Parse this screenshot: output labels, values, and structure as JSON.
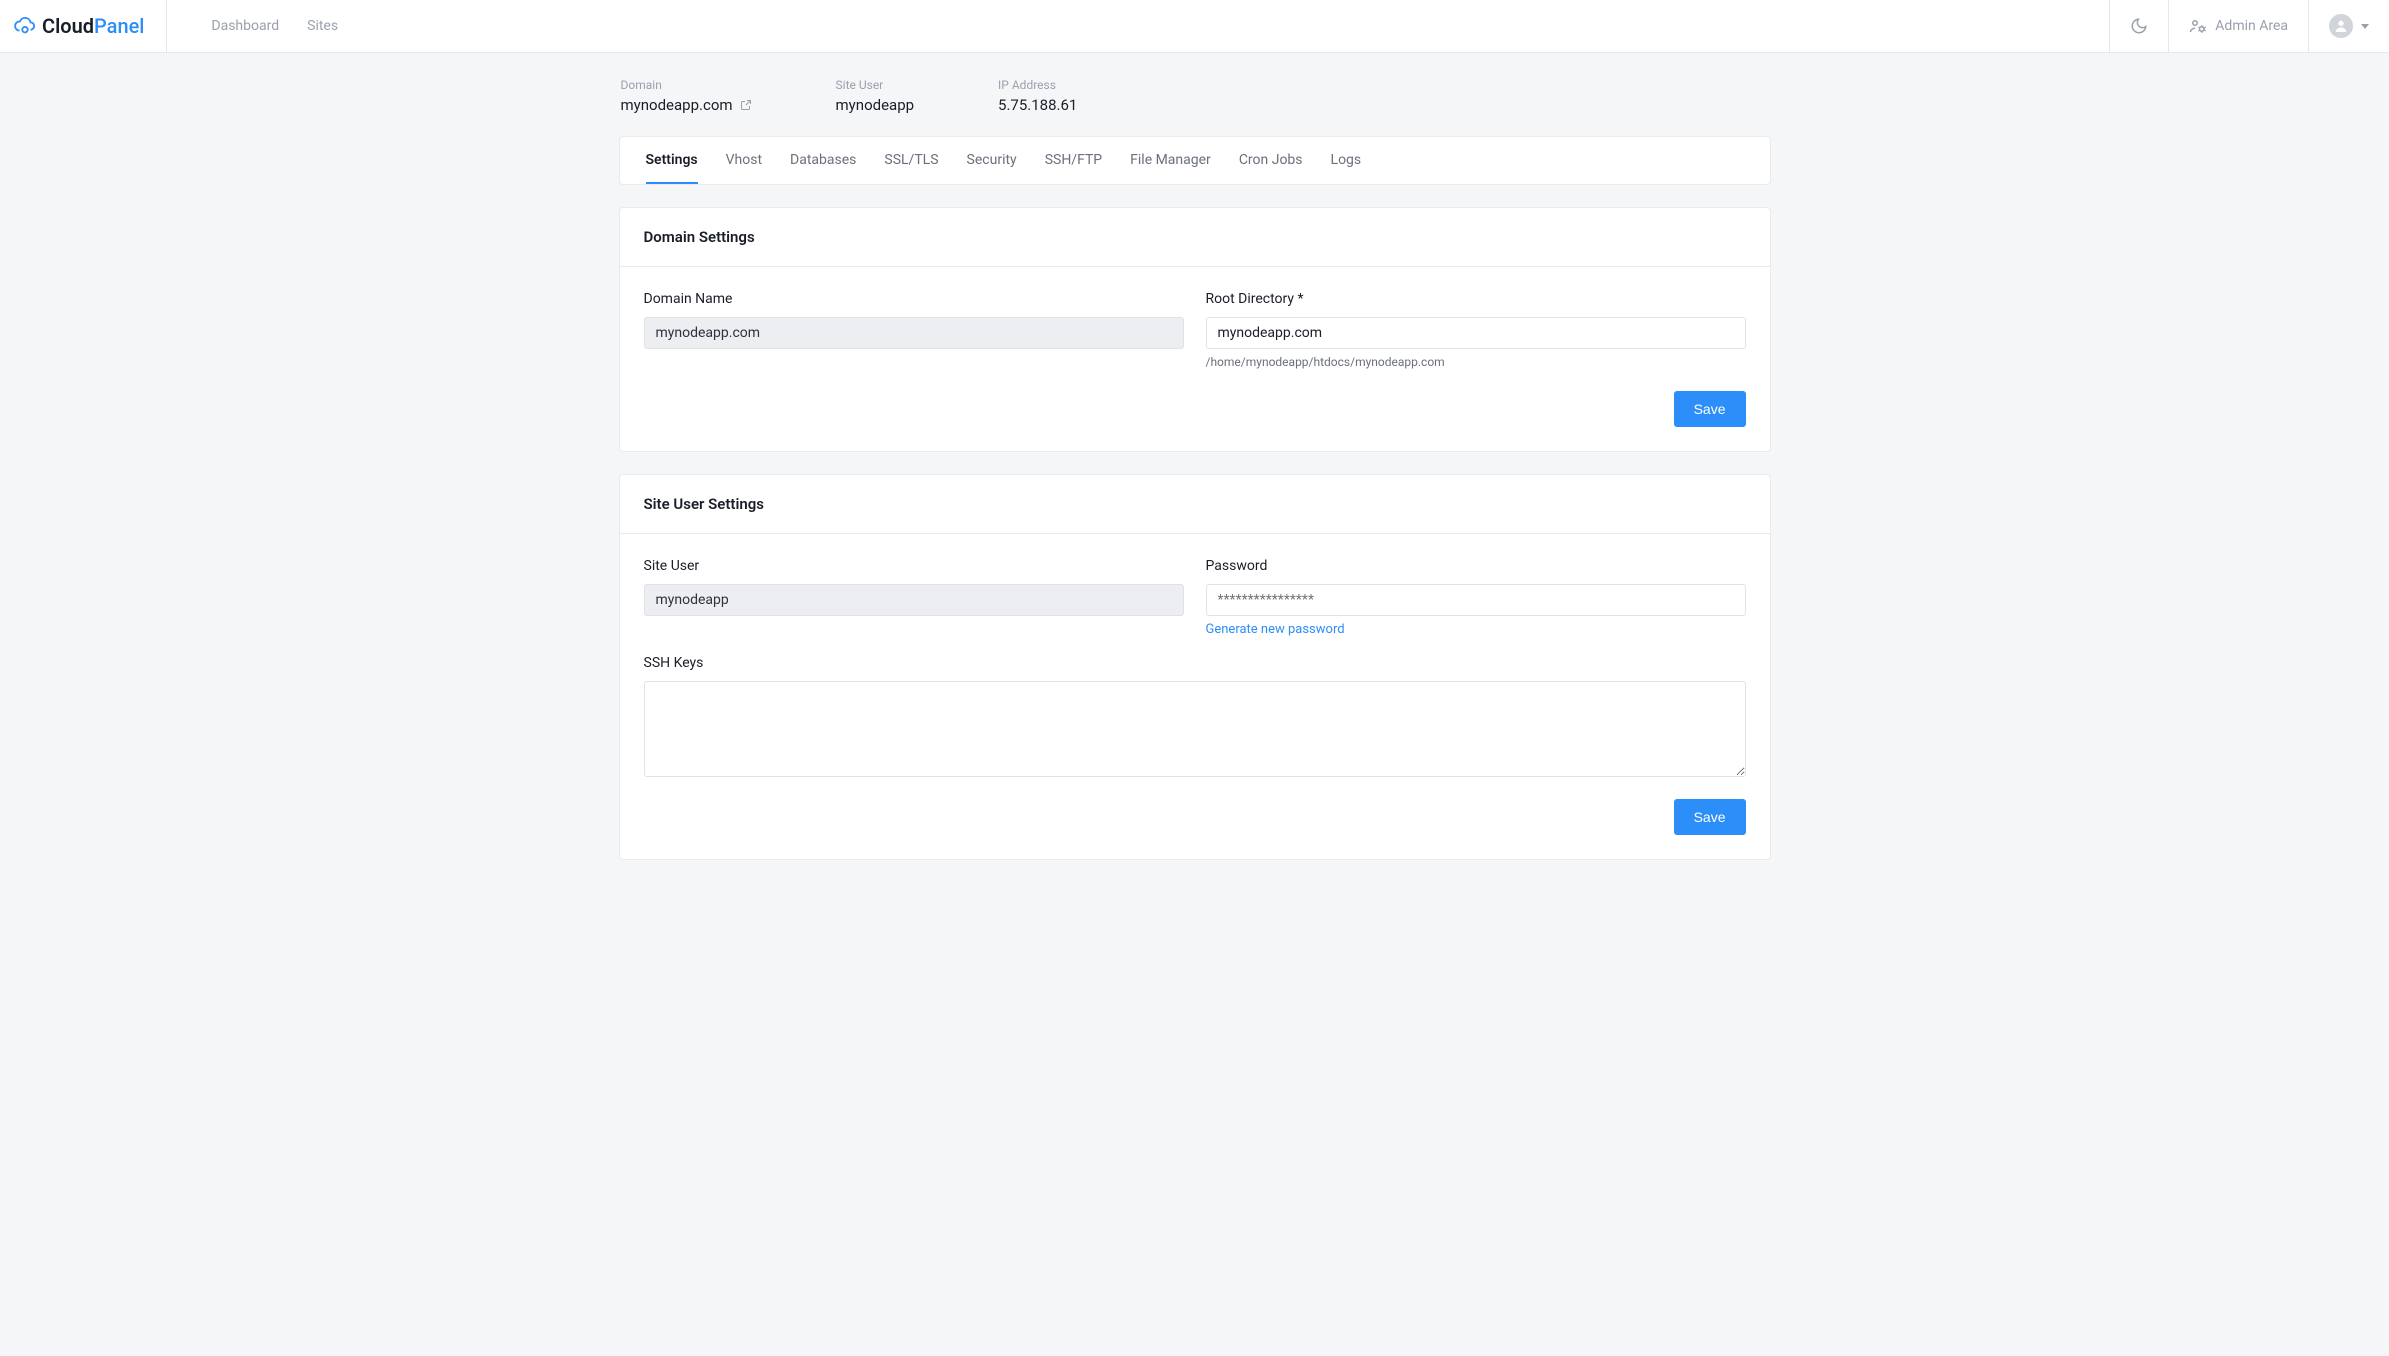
{
  "brand": {
    "name_left": "Cloud",
    "name_right": "Panel"
  },
  "topnav": {
    "dashboard": "Dashboard",
    "sites": "Sites"
  },
  "topbar": {
    "admin_area": "Admin Area"
  },
  "site_header": {
    "domain_label": "Domain",
    "domain_value": "mynodeapp.com",
    "site_user_label": "Site User",
    "site_user_value": "mynodeapp",
    "ip_label": "IP Address",
    "ip_value": "5.75.188.61"
  },
  "tabs": {
    "settings": "Settings",
    "vhost": "Vhost",
    "databases": "Databases",
    "ssltls": "SSL/TLS",
    "security": "Security",
    "sshftp": "SSH/FTP",
    "file_manager": "File Manager",
    "cron_jobs": "Cron Jobs",
    "logs": "Logs"
  },
  "domain_card": {
    "title": "Domain Settings",
    "domain_name_label": "Domain Name",
    "domain_name_value": "mynodeapp.com",
    "root_dir_label": "Root Directory *",
    "root_dir_value": "mynodeapp.com",
    "root_dir_help": "/home/mynodeapp/htdocs/mynodeapp.com",
    "save_label": "Save"
  },
  "siteuser_card": {
    "title": "Site User Settings",
    "site_user_label": "Site User",
    "site_user_value": "mynodeapp",
    "password_label": "Password",
    "password_placeholder": "****************",
    "generate_label": "Generate new password",
    "ssh_keys_label": "SSH Keys",
    "ssh_keys_value": "",
    "save_label": "Save"
  }
}
